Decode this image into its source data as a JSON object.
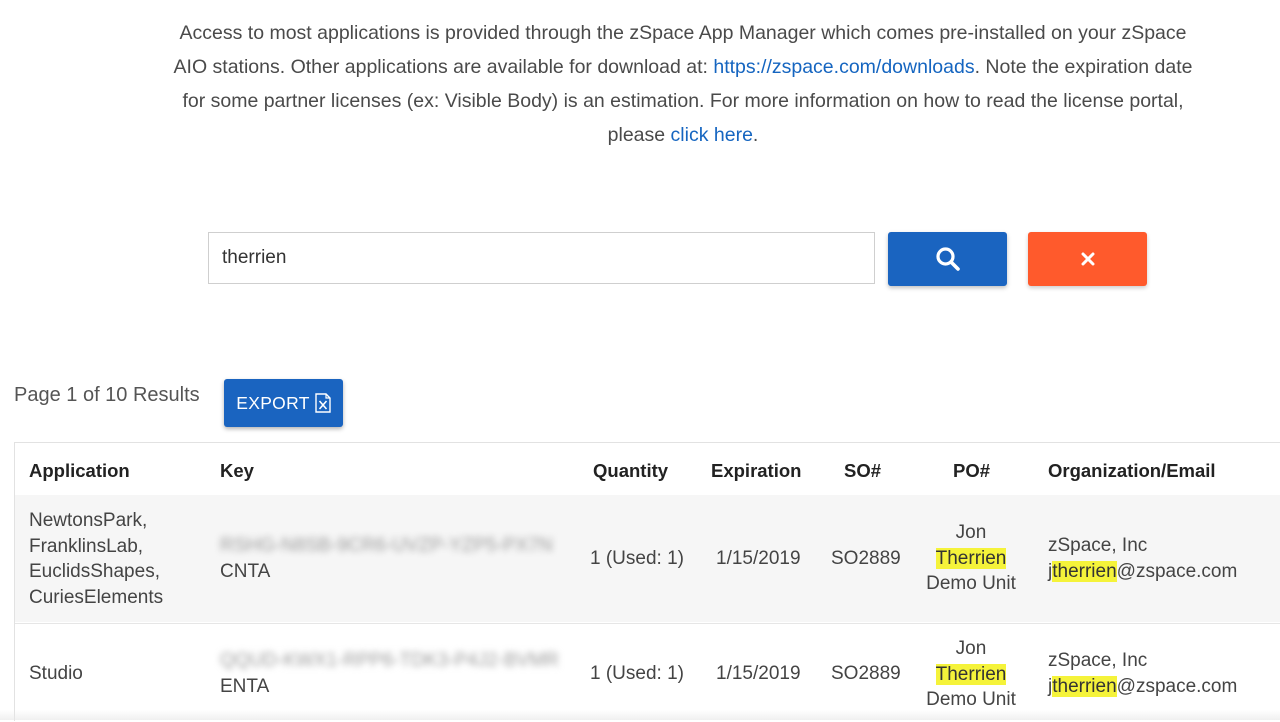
{
  "intro": {
    "text1": "Access to most applications is provided through the zSpace App Manager which comes pre-installed on your zSpace AIO stations. Other applications are available for download at: ",
    "link_downloads": "https://zspace.com/downloads",
    "text2": ". Note the expiration date for some partner licenses (ex: Visible Body) is an estimation. For more information on how to read the license portal, please ",
    "link_click_here": "click here",
    "text3": "."
  },
  "search": {
    "value": "therrien",
    "search_icon": "search-icon",
    "clear_icon": "close-icon"
  },
  "results": {
    "page_info": "Page 1 of 10 Results",
    "export_label": "EXPORT",
    "export_icon": "excel-icon"
  },
  "table": {
    "headers": {
      "application": "Application",
      "key": "Key",
      "quantity": "Quantity",
      "expiration": "Expiration",
      "so": "SO#",
      "po": "PO#",
      "org_email": "Organization/Email"
    },
    "rows": [
      {
        "application": [
          "NewtonsPark,",
          "FranklinsLab,",
          "EuclidsShapes,",
          "CuriesElements"
        ],
        "key_blurred": "RSHG-N8SB-9CR6-UVZP-YZP5-PX7N",
        "key_suffix": "CNTA",
        "quantity": "1 (Used: 1)",
        "expiration": "1/15/2019",
        "so": "SO2889",
        "po_line1": "Jon",
        "po_highlight": "Therrien",
        "po_line3": "Demo Unit",
        "org": "zSpace, Inc",
        "email_pre": "j",
        "email_highlight": "therrien",
        "email_post": "@zspace.com"
      },
      {
        "application": [
          "Studio"
        ],
        "key_blurred": "QQUD-KWX1-RPP6-TDK3-P4J2-BVMR",
        "key_suffix": "ENTA",
        "quantity": "1 (Used: 1)",
        "expiration": "1/15/2019",
        "so": "SO2889",
        "po_line1": "Jon",
        "po_highlight": "Therrien",
        "po_line3": "Demo Unit",
        "org": "zSpace, Inc",
        "email_pre": "j",
        "email_highlight": "therrien",
        "email_post": "@zspace.com"
      }
    ]
  },
  "colors": {
    "primary": "#1a64c0",
    "danger": "#ff5a2c",
    "highlight": "#f5f33a",
    "link": "#1565c0"
  }
}
